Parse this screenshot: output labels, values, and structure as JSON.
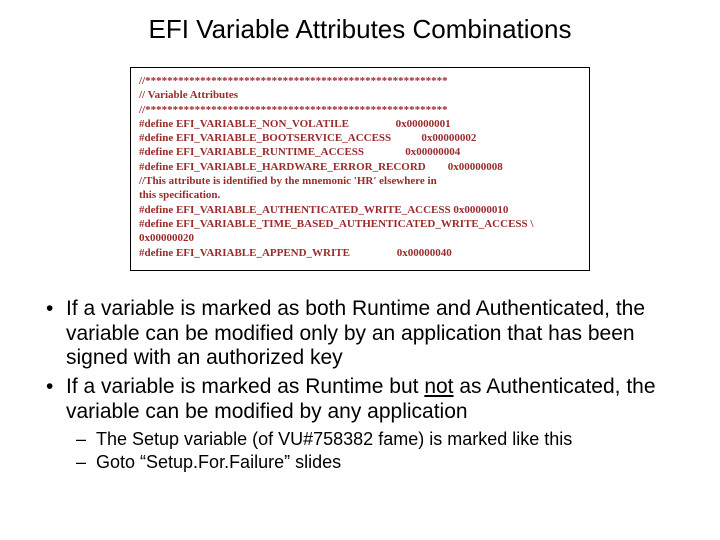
{
  "title": "EFI Variable Attributes Combinations",
  "code": {
    "l0": "//*******************************************************",
    "l1": "// Variable Attributes",
    "l2": "//*******************************************************",
    "l3": "#define EFI_VARIABLE_NON_VOLATILE                 0x00000001",
    "l4": "#define EFI_VARIABLE_BOOTSERVICE_ACCESS           0x00000002",
    "l5": "#define EFI_VARIABLE_RUNTIME_ACCESS               0x00000004",
    "l6": "#define EFI_VARIABLE_HARDWARE_ERROR_RECORD        0x00000008",
    "l7": "//This attribute is identified by the mnemonic 'HR' elsewhere in",
    "l8": "this specification.",
    "l9": "#define EFI_VARIABLE_AUTHENTICATED_WRITE_ACCESS 0x00000010",
    "l10": "#define EFI_VARIABLE_TIME_BASED_AUTHENTICATED_WRITE_ACCESS \\",
    "l11": "0x00000020",
    "l12": "#define EFI_VARIABLE_APPEND_WRITE                 0x00000040"
  },
  "bullets": {
    "b1": "If a variable is marked as both Runtime and Authenticated, the variable can be modified only by an application that has been signed with an authorized key",
    "b2_pre": "If a variable is marked as Runtime but ",
    "b2_not": "not",
    "b2_post": " as Authenticated, the variable can be modified by any application",
    "s1_pre": "The Setup variable (of ",
    "s1_vu": "VU#758382",
    "s1_post": " fame) is marked like this",
    "s2": "Goto “Setup.For.Failure” slides"
  }
}
